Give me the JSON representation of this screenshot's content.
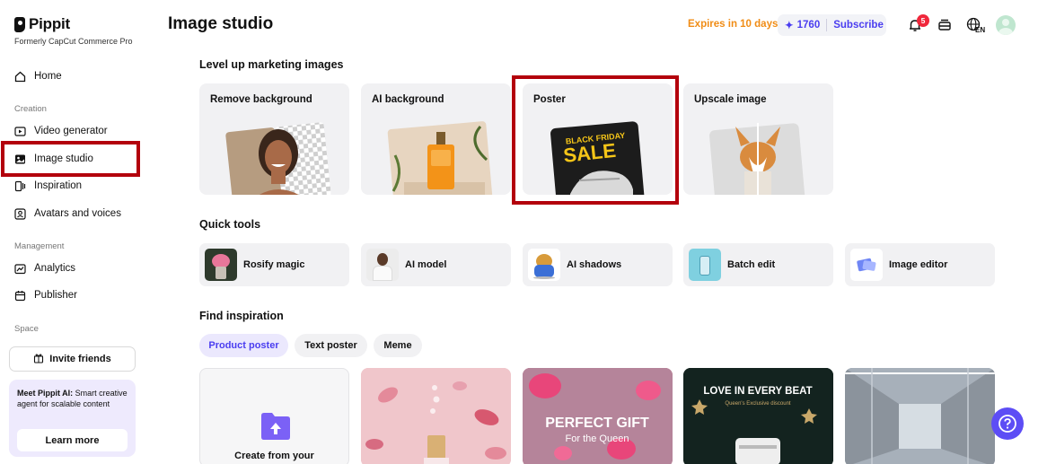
{
  "brand": {
    "name": "Pippit",
    "subtitle": "Formerly CapCut Commerce Pro"
  },
  "sidebar": {
    "home": "Home",
    "creation_label": "Creation",
    "video_generator": "Video generator",
    "image_studio": "Image studio",
    "inspiration": "Inspiration",
    "avatars": "Avatars and voices",
    "management_label": "Management",
    "analytics": "Analytics",
    "publisher": "Publisher",
    "space_label": "Space",
    "invite": "Invite friends",
    "promo_bold": "Meet Pippit AI:",
    "promo_text": " Smart creative agent for scalable content",
    "promo_button": "Learn more"
  },
  "header": {
    "title": "Image studio",
    "expires": "Expires in 10 days",
    "credits": "1760",
    "subscribe": "Subscribe",
    "notif_count": "5",
    "lang": "EN"
  },
  "level_up": {
    "title": "Level up marketing images",
    "cards": [
      "Remove background",
      "AI background",
      "Poster",
      "Upscale image"
    ]
  },
  "quick_tools": {
    "title": "Quick tools",
    "items": [
      "Rosify magic",
      "AI model",
      "AI shadows",
      "Batch edit",
      "Image editor"
    ]
  },
  "find_inspiration": {
    "title": "Find inspiration",
    "filters": [
      "Product poster",
      "Text poster",
      "Meme"
    ],
    "create_label": "Create from your",
    "poster_perfect_gift": "PERFECT GIFT",
    "poster_for_queen": "For the Queen",
    "poster_love": "LOVE IN EVERY BEAT",
    "poster_love_sub": "Queen's Exclusive discount",
    "poster_black_friday": "BLACK FRIDAY",
    "poster_sale": "SALE"
  },
  "colors": {
    "accent": "#4a3df0",
    "highlight": "#b3000c",
    "expires": "#f08c15"
  }
}
